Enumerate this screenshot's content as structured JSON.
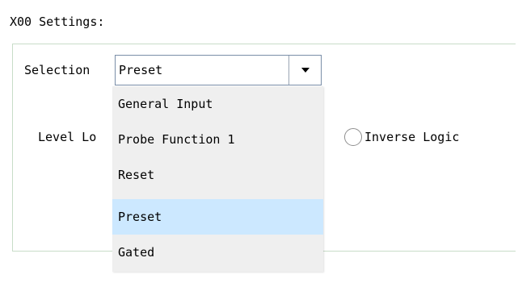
{
  "group": {
    "title": "X00 Settings:"
  },
  "selection": {
    "label": "Selection",
    "value": "Preset",
    "button_icon": "chevron-down-icon"
  },
  "level_logic": {
    "label": "Level Lo"
  },
  "inverse_logic": {
    "label": "Inverse Logic",
    "checked": false
  },
  "dropdown": {
    "options": [
      "General Input",
      "Probe Function 1",
      "Reset",
      "Preset",
      "Gated"
    ],
    "selected": "Preset",
    "highlight_color": "#cce8ff",
    "background_color": "#efefef"
  }
}
